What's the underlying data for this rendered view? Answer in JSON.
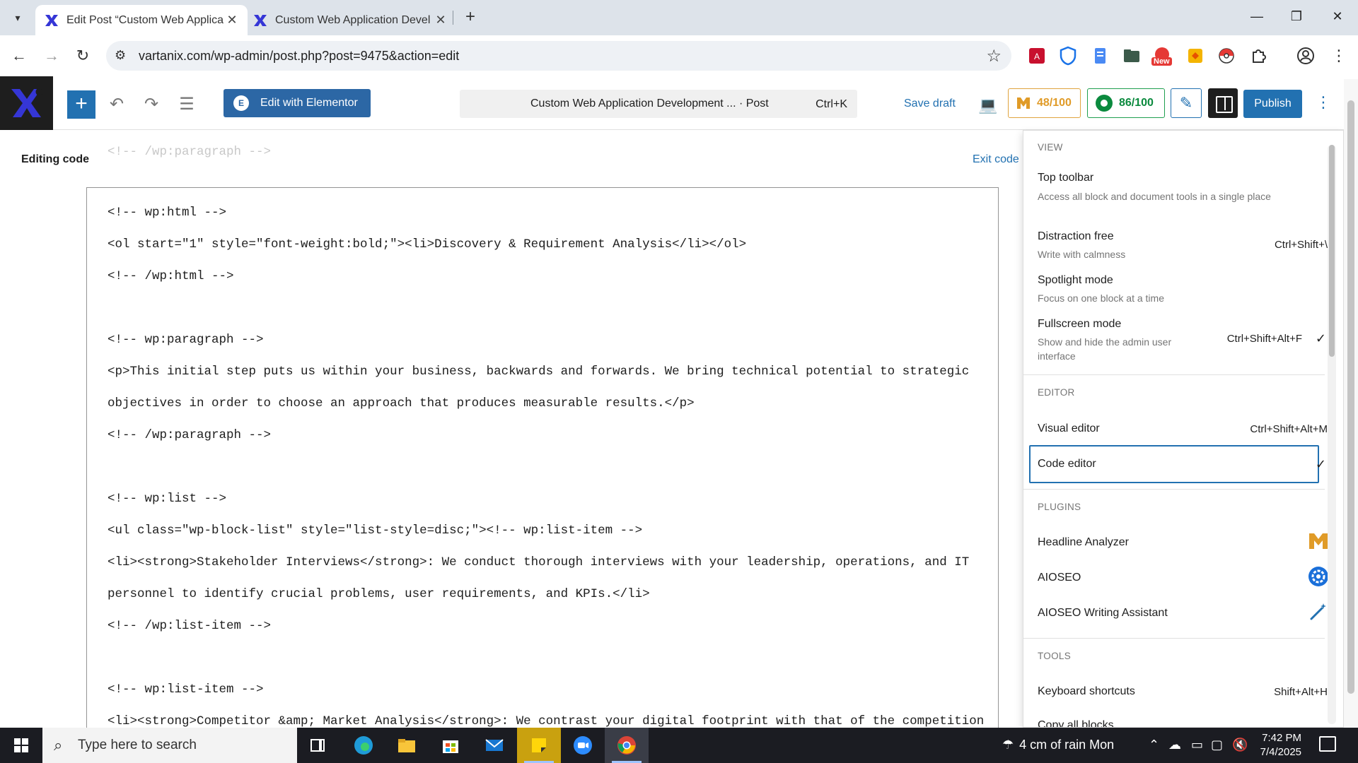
{
  "browser": {
    "tabs": [
      {
        "title": "Edit Post “Custom Web Applica",
        "active": true
      },
      {
        "title": "Custom Web Application Devel",
        "active": false
      }
    ],
    "url": "vartanix.com/wp-admin/post.php?post=9475&action=edit",
    "new_badge": "New"
  },
  "toolbar": {
    "elementor_label": "Edit with Elementor",
    "command_title": "Custom Web Application Development ... · Post",
    "command_shortcut": "Ctrl+K",
    "save_draft": "Save draft",
    "headline_score": "48/100",
    "seo_score": "86/100",
    "publish": "Publish"
  },
  "editor": {
    "editing_label": "Editing code",
    "exit_label": "Exit code",
    "lines": [
      "<!-- /wp:paragraph -->",
      "<!-- wp:html -->",
      "<ol start=\"1\" style=\"font-weight:bold;\"><li>Discovery & Requirement Analysis</li></ol>",
      "<!-- /wp:html -->",
      "<!-- wp:paragraph -->",
      "<p>This initial step puts us within your business, backwards and forwards. We bring technical potential to strategic",
      "objectives in order to choose an approach that produces measurable results.</p>",
      "<!-- /wp:paragraph -->",
      "<!-- wp:list -->",
      "<ul class=\"wp-block-list\" style=\"list-style=disc;\"><!-- wp:list-item -->",
      "<li><strong>Stakeholder Interviews</strong>: We conduct thorough interviews with your leadership, operations, and IT",
      "personnel to identify crucial problems, user requirements, and KPIs.</li>",
      "<!-- /wp:list-item -->",
      "<!-- wp:list-item -->",
      "<li><strong>Competitor &amp; Market Analysis</strong>: We contrast your digital footprint with that of the competition"
    ]
  },
  "menu": {
    "view_title": "VIEW",
    "top_toolbar": {
      "label": "Top toolbar",
      "desc": "Access all block and document tools in a single place"
    },
    "distraction_free": {
      "label": "Distraction free",
      "desc": "Write with calmness",
      "shortcut": "Ctrl+Shift+\\"
    },
    "spotlight": {
      "label": "Spotlight mode",
      "desc": "Focus on one block at a time"
    },
    "fullscreen": {
      "label": "Fullscreen mode",
      "desc": "Show and hide the admin user interface",
      "shortcut": "Ctrl+Shift+Alt+F",
      "check": "✓"
    },
    "editor_title": "EDITOR",
    "visual_editor": {
      "label": "Visual editor",
      "shortcut": "Ctrl+Shift+Alt+M"
    },
    "code_editor": {
      "label": "Code editor",
      "check": "✓"
    },
    "plugins_title": "PLUGINS",
    "headline_analyzer": "Headline Analyzer",
    "aioseo": "AIOSEO",
    "aioseo_wa": "AIOSEO Writing Assistant",
    "tools_title": "TOOLS",
    "keyboard_shortcuts": {
      "label": "Keyboard shortcuts",
      "shortcut": "Shift+Alt+H"
    },
    "copy_all": "Copy all blocks"
  },
  "taskbar": {
    "search_placeholder": "Type here to search",
    "weather": "4 cm of rain Mon",
    "time": "7:42 PM",
    "date": "7/4/2025"
  },
  "colors": {
    "wp_blue": "#2271b1",
    "headline_orange": "#e09b28",
    "seo_green": "#0b8a3e"
  }
}
